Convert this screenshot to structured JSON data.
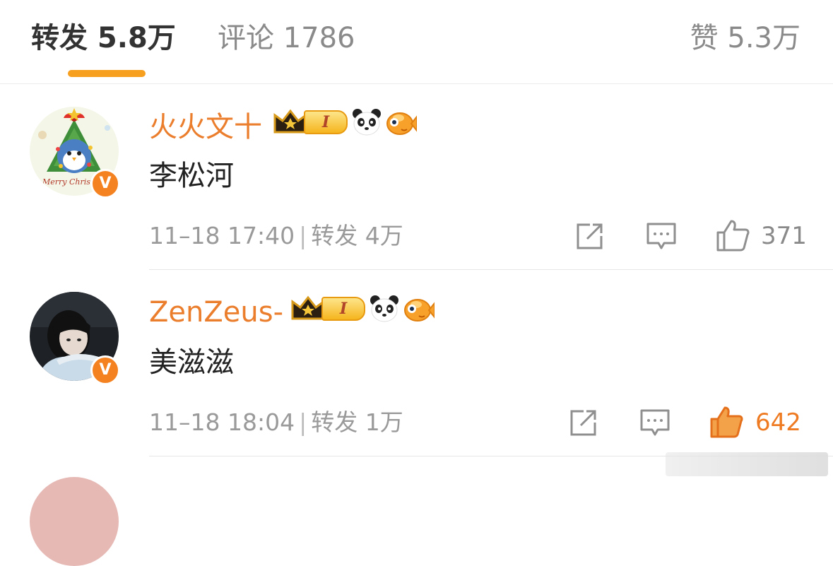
{
  "tabs": {
    "reposts_label": "转发 5.8万",
    "comments_label": "评论 1786",
    "likes_label": "赞 5.3万"
  },
  "colors": {
    "accent": "#f79f1f",
    "username": "#eb7e2d",
    "liked": "#ee7a22"
  },
  "comments": [
    {
      "username": "火火文十",
      "level": "I",
      "text": "李松河",
      "timestamp": "11–18 17:40",
      "separator": "|",
      "reposts": "转发 4万",
      "likes": "371",
      "liked": false,
      "icons": [
        "crown-icon",
        "panda-icon",
        "fish-icon",
        "share-icon",
        "comment-icon",
        "thumbs-up-icon"
      ],
      "avatar_text": "Merry Christmas"
    },
    {
      "username": "ZenZeus-",
      "level": "I",
      "text": "美滋滋",
      "timestamp": "11–18 18:04",
      "separator": "|",
      "reposts": "转发 1万",
      "likes": "642",
      "liked": true,
      "icons": [
        "crown-icon",
        "panda-icon",
        "fish-icon",
        "share-icon",
        "comment-icon",
        "thumbs-up-icon"
      ]
    }
  ]
}
